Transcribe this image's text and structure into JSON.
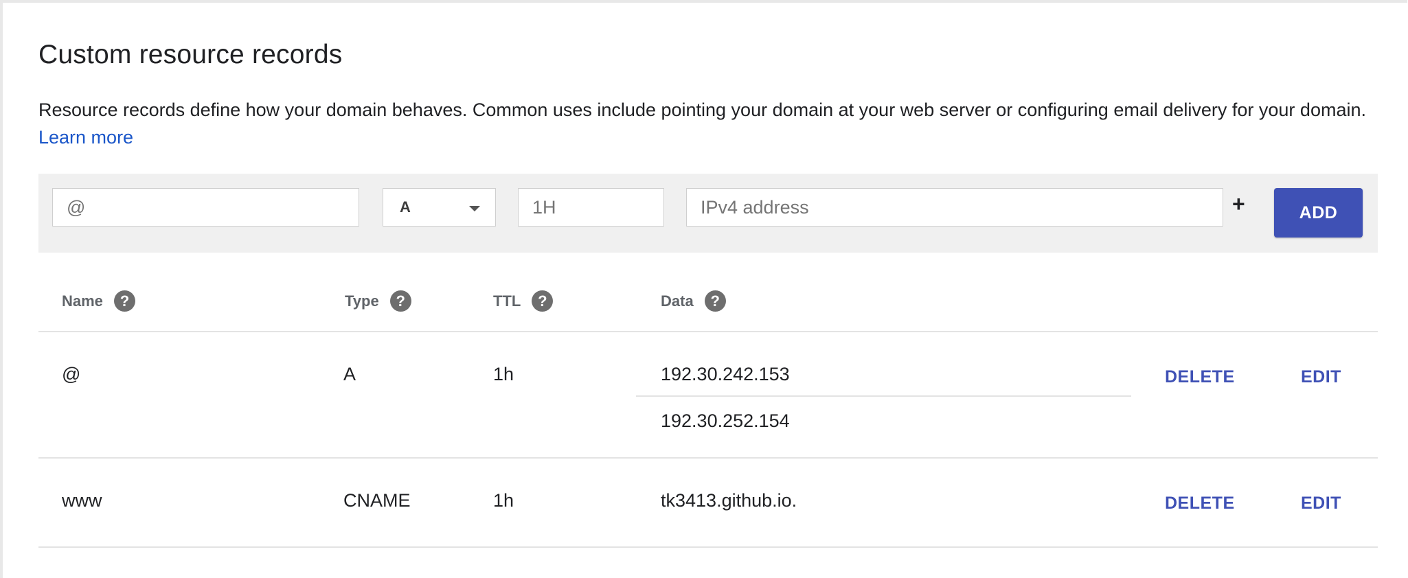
{
  "section": {
    "title": "Custom resource records",
    "description": "Resource records define how your domain behaves. Common uses include pointing your domain at your web server or configuring email delivery for your domain.",
    "learn_more": "Learn more"
  },
  "add_form": {
    "name_placeholder": "@",
    "type_value": "A",
    "ttl_placeholder": "1H",
    "data_placeholder": "IPv4 address",
    "plus_label": "+",
    "add_label": "ADD"
  },
  "table": {
    "headers": {
      "name": "Name",
      "type": "Type",
      "ttl": "TTL",
      "data": "Data"
    },
    "help_glyph": "?",
    "rows": [
      {
        "name": "@",
        "type": "A",
        "ttl": "1h",
        "data": [
          "192.30.242.153",
          "192.30.252.154"
        ],
        "delete_label": "DELETE",
        "edit_label": "EDIT"
      },
      {
        "name": "www",
        "type": "CNAME",
        "ttl": "1h",
        "data": [
          "tk3413.github.io."
        ],
        "delete_label": "DELETE",
        "edit_label": "EDIT"
      }
    ]
  },
  "colors": {
    "accent": "#3f51b5",
    "link": "#1a56c9",
    "bar_bg": "#f0f0f0"
  }
}
